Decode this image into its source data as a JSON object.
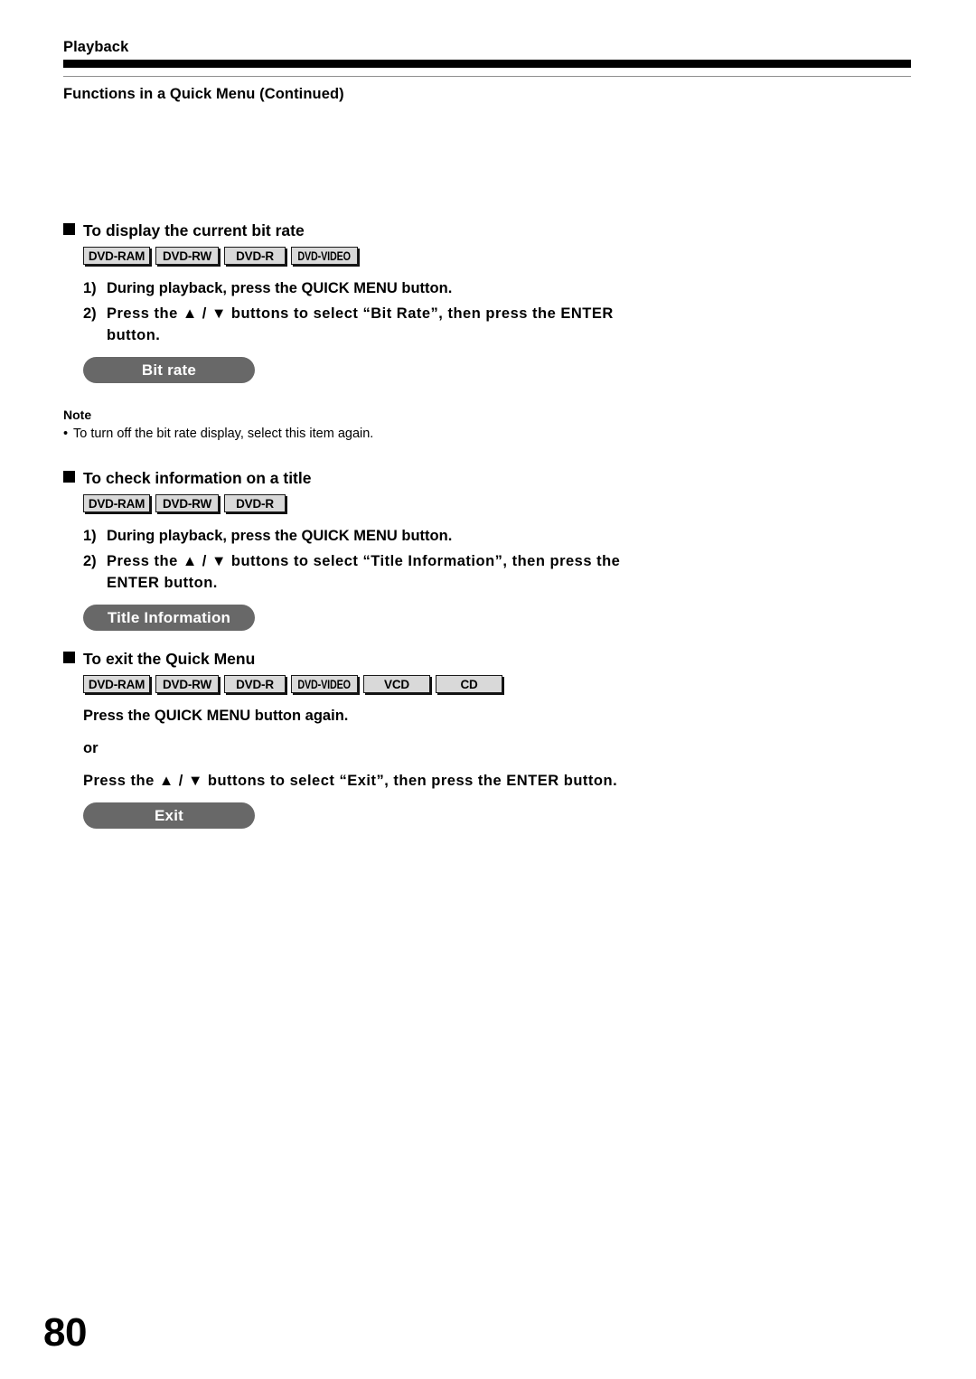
{
  "header": {
    "chapter": "Playback",
    "section_title": "Functions in a Quick Menu (Continued)"
  },
  "sections": [
    {
      "heading": "To display the current bit rate",
      "badges": [
        "DVD-RAM",
        "DVD-RW",
        "DVD-R",
        "DVD-VIDEO"
      ],
      "steps": [
        {
          "num": "1)",
          "text": "During playback, press the QUICK MENU button."
        },
        {
          "num": "2)",
          "text": "Press the ▲ / ▼ buttons to select “Bit Rate”, then press the ENTER button."
        }
      ],
      "pill": "Bit rate",
      "note": {
        "label": "Note",
        "bullet": "•",
        "items": [
          "To turn off the bit rate display, select this item again."
        ]
      }
    },
    {
      "heading": "To check information on a title",
      "badges": [
        "DVD-RAM",
        "DVD-RW",
        "DVD-R"
      ],
      "steps": [
        {
          "num": "1)",
          "text": "During playback, press the QUICK MENU button."
        },
        {
          "num": "2)",
          "text": "Press the ▲ / ▼ buttons to select “Title Information”, then press the ENTER button."
        }
      ],
      "pill": "Title Information"
    },
    {
      "heading": "To exit the Quick Menu",
      "badges": [
        "DVD-RAM",
        "DVD-RW",
        "DVD-R",
        "DVD-VIDEO",
        "VCD",
        "CD"
      ],
      "lines": [
        "Press the QUICK MENU button again.",
        "or",
        "Press the ▲ / ▼ buttons to select “Exit”, then press the ENTER button."
      ],
      "pill": "Exit"
    }
  ],
  "folio": "80",
  "colors": {
    "rule": "#000000",
    "thin_rule": "#8f8f8f",
    "badge_fill": "#d9d9d9",
    "badge_border": "#1a1a1a",
    "pill_fill": "#686868",
    "pill_text": "#ffffff"
  }
}
